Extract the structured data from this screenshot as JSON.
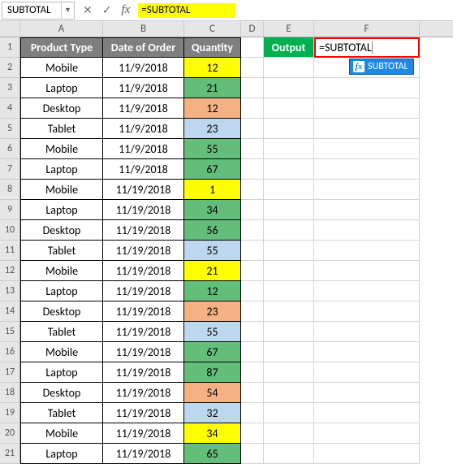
{
  "formula_bar": {
    "name_box": "SUBTOTAL",
    "cancel": "✕",
    "accept": "✓",
    "fx": "fx",
    "formula": "=SUBTOTAL"
  },
  "columns": [
    "A",
    "B",
    "C",
    "D",
    "E",
    "F"
  ],
  "row_numbers": [
    "1",
    "2",
    "3",
    "4",
    "5",
    "6",
    "7",
    "8",
    "9",
    "10",
    "11",
    "12",
    "13",
    "14",
    "15",
    "16",
    "17",
    "18",
    "19",
    "20",
    "21"
  ],
  "headers": {
    "a": "Product Type",
    "b": "Date of Order",
    "c": "Quantity"
  },
  "output_label": "Output",
  "editing_value": "=SUBTOTAL",
  "suggestion": "SUBTOTAL",
  "rows": [
    {
      "a": "Mobile",
      "b": "11/9/2018",
      "c": "12",
      "bg": "bg-yellow"
    },
    {
      "a": "Laptop",
      "b": "11/9/2018",
      "c": "21",
      "bg": "bg-green"
    },
    {
      "a": "Desktop",
      "b": "11/9/2018",
      "c": "12",
      "bg": "bg-peach"
    },
    {
      "a": "Tablet",
      "b": "11/9/2018",
      "c": "23",
      "bg": "bg-sky"
    },
    {
      "a": "Mobile",
      "b": "11/9/2018",
      "c": "55",
      "bg": "bg-green"
    },
    {
      "a": "Laptop",
      "b": "11/9/2018",
      "c": "67",
      "bg": "bg-green"
    },
    {
      "a": "Mobile",
      "b": "11/19/2018",
      "c": "1",
      "bg": "bg-yellow"
    },
    {
      "a": "Laptop",
      "b": "11/19/2018",
      "c": "34",
      "bg": "bg-green"
    },
    {
      "a": "Desktop",
      "b": "11/19/2018",
      "c": "56",
      "bg": "bg-green"
    },
    {
      "a": "Tablet",
      "b": "11/19/2018",
      "c": "55",
      "bg": "bg-sky"
    },
    {
      "a": "Mobile",
      "b": "11/19/2018",
      "c": "21",
      "bg": "bg-yellow"
    },
    {
      "a": "Laptop",
      "b": "11/19/2018",
      "c": "12",
      "bg": "bg-green"
    },
    {
      "a": "Desktop",
      "b": "11/19/2018",
      "c": "23",
      "bg": "bg-peach"
    },
    {
      "a": "Tablet",
      "b": "11/19/2018",
      "c": "55",
      "bg": "bg-sky"
    },
    {
      "a": "Mobile",
      "b": "11/19/2018",
      "c": "67",
      "bg": "bg-green"
    },
    {
      "a": "Laptop",
      "b": "11/19/2018",
      "c": "87",
      "bg": "bg-green"
    },
    {
      "a": "Desktop",
      "b": "11/19/2018",
      "c": "54",
      "bg": "bg-peach"
    },
    {
      "a": "Tablet",
      "b": "11/19/2018",
      "c": "32",
      "bg": "bg-sky"
    },
    {
      "a": "Mobile",
      "b": "11/19/2018",
      "c": "34",
      "bg": "bg-yellow"
    },
    {
      "a": "Laptop",
      "b": "11/19/2018",
      "c": "65",
      "bg": "bg-green"
    }
  ]
}
